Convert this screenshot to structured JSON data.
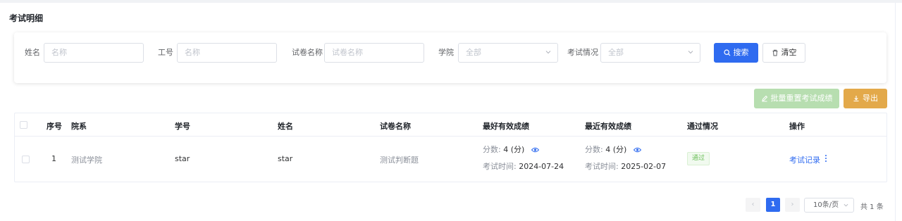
{
  "page": {
    "title": "考试明细"
  },
  "filters": {
    "name_label": "姓名",
    "name_placeholder": "名称",
    "workno_label": "工号",
    "workno_placeholder": "名称",
    "paper_label": "试卷名称",
    "paper_placeholder": "试卷名称",
    "college_label": "学院",
    "college_value": "全部",
    "status_label": "考试情况",
    "status_value": "全部",
    "search_label": "搜索",
    "clear_label": "清空"
  },
  "actions": {
    "batch_reset_label": "批量重置考试成绩",
    "export_label": "导出"
  },
  "table": {
    "headers": {
      "index": "序号",
      "department": "院系",
      "student_no": "学号",
      "name": "姓名",
      "paper": "试卷名称",
      "best": "最好有效成绩",
      "latest": "最近有效成绩",
      "pass": "通过情况",
      "ops": "操作"
    },
    "rows": [
      {
        "index": "1",
        "department": "测试学院",
        "student_no": "star",
        "name": "star",
        "paper": "测试判断题",
        "best_score_label": "分数:",
        "best_score": "4 (分)",
        "best_time_label": "考试时间:",
        "best_time": "2024-07-24",
        "latest_score_label": "分数:",
        "latest_score": "4 (分)",
        "latest_time_label": "考试时间:",
        "latest_time": "2025-02-07",
        "pass": "通过",
        "op_link": "考试记录"
      }
    ]
  },
  "pagination": {
    "prev": "‹",
    "current": "1",
    "next": "›",
    "page_size": "10条/页",
    "total": "共 1 条"
  },
  "colors": {
    "primary": "#2f6bf0",
    "success_light": "#b7deb0",
    "warning": "#e3a94a",
    "pass_text": "#6cbf5a"
  }
}
